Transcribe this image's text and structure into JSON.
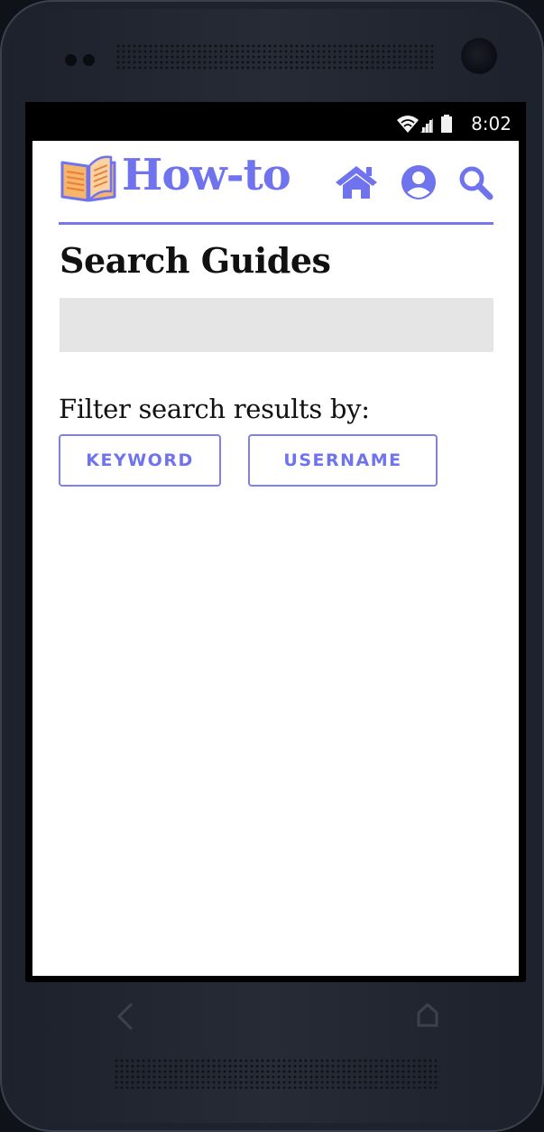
{
  "status_bar": {
    "time": "8:02",
    "icons": [
      "wifi-icon",
      "signal-icon",
      "battery-icon"
    ]
  },
  "header": {
    "logo_icon": "open-book-icon",
    "brand": "How-to",
    "nav_icons": [
      "home-icon",
      "user-icon",
      "search-icon"
    ]
  },
  "main": {
    "title": "Search Guides",
    "search": {
      "value": "",
      "placeholder": ""
    },
    "filter_label": "Filter search results by:",
    "filters": [
      {
        "label": "KEYWORD"
      },
      {
        "label": "USERNAME"
      }
    ]
  },
  "device_nav": {
    "back_icon": "back-chevron-icon",
    "home_icon": "home-outline-icon"
  },
  "colors": {
    "accent": "#6f73ee",
    "rule": "#7478f0",
    "logo_orange": "#f5a04a",
    "input_bg": "#e5e5e5"
  }
}
